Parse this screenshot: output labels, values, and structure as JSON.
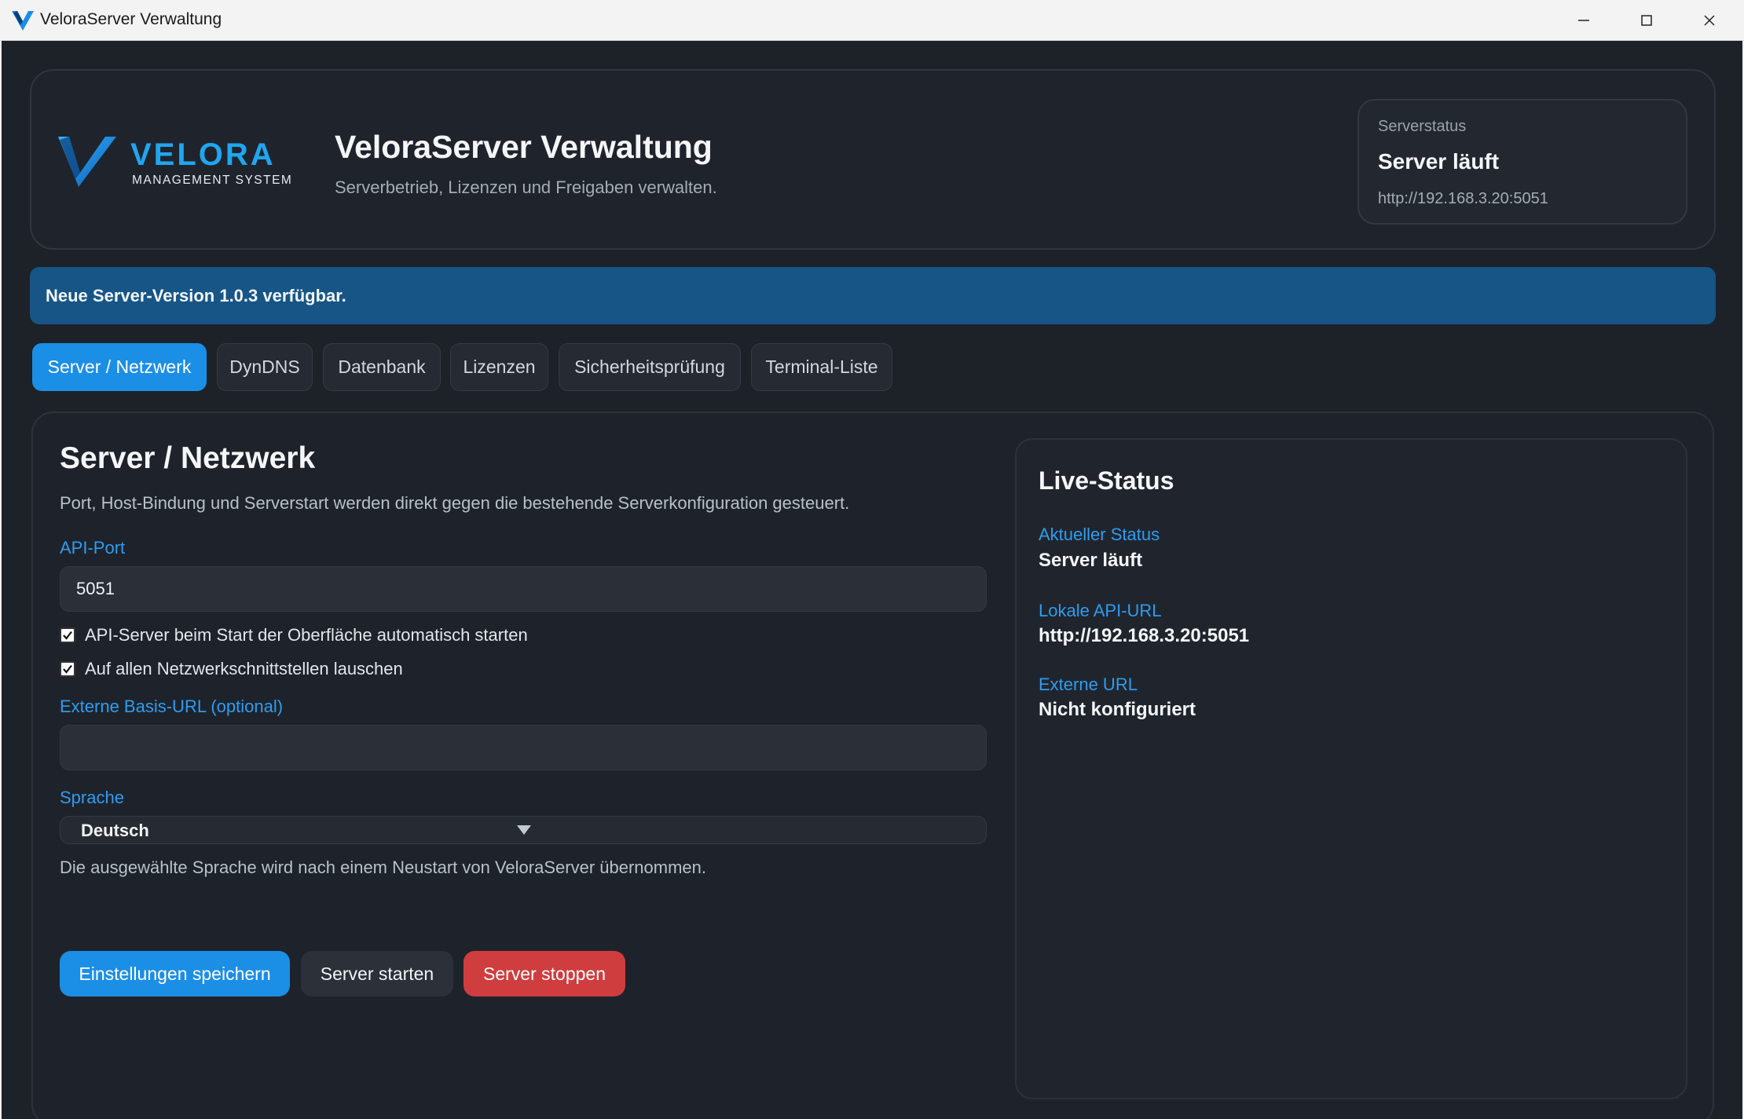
{
  "window": {
    "title": "VeloraServer Verwaltung",
    "controls": [
      "minimize-icon",
      "maximize-icon",
      "close-icon"
    ]
  },
  "header": {
    "logo_word": "VELORA",
    "logo_sub": "MANAGEMENT SYSTEM",
    "title": "VeloraServer Verwaltung",
    "subtitle": "Serverbetrieb, Lizenzen und Freigaben verwalten.",
    "status": {
      "label": "Serverstatus",
      "value": "Server läuft",
      "url": "http://192.168.3.20:5051"
    }
  },
  "banner": {
    "text": "Neue Server-Version 1.0.3 verfügbar."
  },
  "tabs": [
    {
      "label": "Server / Netzwerk",
      "active": true
    },
    {
      "label": "DynDNS",
      "active": false
    },
    {
      "label": "Datenbank",
      "active": false
    },
    {
      "label": "Lizenzen",
      "active": false
    },
    {
      "label": "Sicherheitsprüfung",
      "active": false
    },
    {
      "label": "Terminal-Liste",
      "active": false
    }
  ],
  "section": {
    "title": "Server / Netzwerk",
    "description": "Port, Host-Bindung und Serverstart werden direkt gegen die bestehende Serverkonfiguration gesteuert.",
    "api_port": {
      "label": "API-Port",
      "value": "5051"
    },
    "autostart": {
      "label": "API-Server beim Start der Oberfläche automatisch starten",
      "checked": true
    },
    "listen_all": {
      "label": "Auf allen Netzwerkschnittstellen lauschen",
      "checked": true
    },
    "external_url": {
      "label": "Externe Basis-URL (optional)",
      "value": ""
    },
    "language": {
      "label": "Sprache",
      "value": "Deutsch",
      "hint": "Die ausgewählte Sprache wird nach einem Neustart von VeloraServer übernommen."
    },
    "buttons": {
      "save": "Einstellungen speichern",
      "start": "Server starten",
      "stop": "Server stoppen"
    }
  },
  "live_status": {
    "title": "Live-Status",
    "current_label": "Aktueller Status",
    "current_value": "Server läuft",
    "local_label": "Lokale API-URL",
    "local_value": "http://192.168.3.20:5051",
    "external_label": "Externe URL",
    "external_value": "Nicht konfiguriert"
  },
  "colors": {
    "accent": "#1b8ee6",
    "banner": "#165586",
    "danger": "#cf3d3f",
    "background": "#1d2128",
    "label_blue": "#2e9cf0"
  }
}
